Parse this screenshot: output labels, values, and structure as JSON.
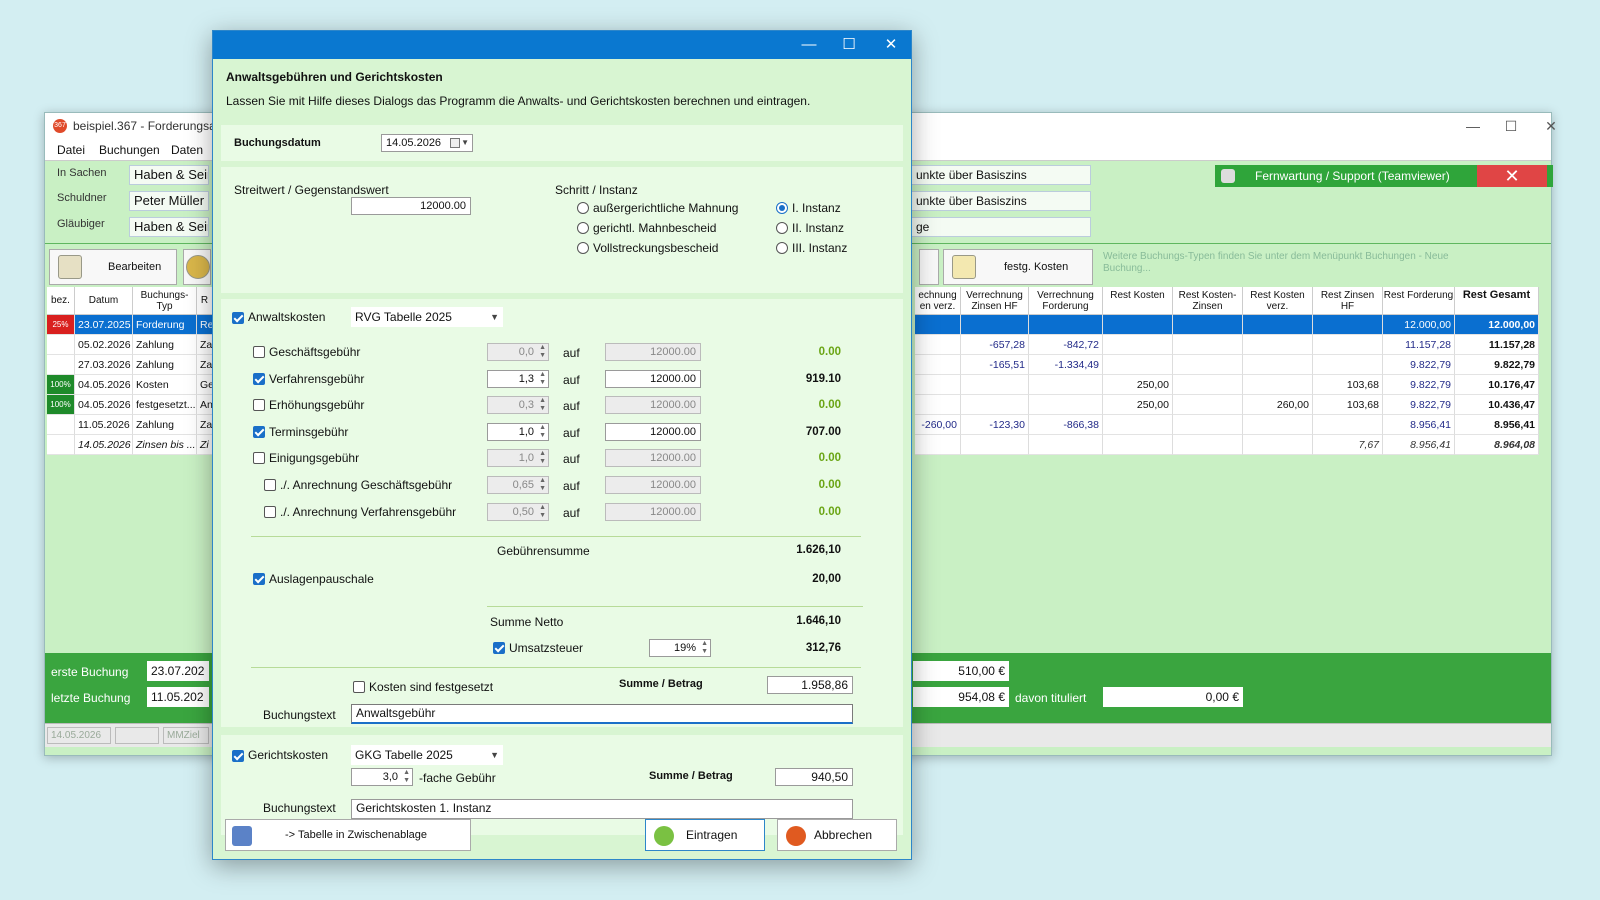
{
  "main_window": {
    "title": "beispiel.367 - Forderungsauf",
    "menu": [
      "Datei",
      "Buchungen",
      "Daten"
    ],
    "teamviewer_label": "Fernwartung / Support (Teamviewer)",
    "fields": [
      {
        "label": "In Sachen",
        "value": "Haben & Sein"
      },
      {
        "label": "Schuldner",
        "value": "Peter Müller"
      },
      {
        "label": "Gläubiger",
        "value": "Haben & Sein"
      }
    ],
    "right_fields": [
      "unkte über Basiszins",
      "unkte über Basiszins",
      "ge"
    ],
    "toolbar": {
      "edit_label": "Bearbeiten",
      "fixed_costs_label": "festg. Kosten"
    },
    "hint_text": "Weitere Buchungs-Typen finden Sie unter dem Menüpunkt Buchungen - Neue Buchung...",
    "left_headers": [
      "bez.",
      "Datum",
      "Buchungs-Typ",
      "R"
    ],
    "right_headers": [
      "echnung en verz.",
      "Verrechnung Zinsen HF",
      "Verrechnung Forderung",
      "Rest Kosten",
      "Rest Kosten-Zinsen",
      "Rest Kosten verz.",
      "Rest Zinsen HF",
      "Rest Forderung",
      "Rest Gesamt"
    ],
    "rows": [
      {
        "badge": "25%",
        "badge_color": "#d9201f",
        "date": "23.07.2025",
        "type": "Forderung",
        "r": "Re",
        "cols": [
          "",
          "",
          "",
          "",
          "",
          "",
          "",
          "12.000,00",
          "12.000,00"
        ],
        "selected": true
      },
      {
        "badge": "",
        "badge_color": "",
        "date": "05.02.2026",
        "type": "Zahlung",
        "r": "Za",
        "cols": [
          "",
          "-657,28",
          "-842,72",
          "",
          "",
          "",
          "",
          "11.157,28",
          "11.157,28"
        ]
      },
      {
        "badge": "",
        "badge_color": "",
        "date": "27.03.2026",
        "type": "Zahlung",
        "r": "Za",
        "cols": [
          "",
          "-165,51",
          "-1.334,49",
          "",
          "",
          "",
          "",
          "9.822,79",
          "9.822,79"
        ]
      },
      {
        "badge": "100%",
        "badge_color": "#1e8a2a",
        "date": "04.05.2026",
        "type": "Kosten",
        "r": "Ge",
        "cols": [
          "",
          "",
          "",
          "250,00",
          "",
          "",
          "103,68",
          "9.822,79",
          "10.176,47"
        ]
      },
      {
        "badge": "100%",
        "badge_color": "#1e8a2a",
        "date": "04.05.2026",
        "type": "festgesetzt...",
        "r": "An",
        "cols": [
          "",
          "",
          "",
          "250,00",
          "",
          "260,00",
          "103,68",
          "9.822,79",
          "10.436,47"
        ]
      },
      {
        "badge": "",
        "badge_color": "",
        "date": "11.05.2026",
        "type": "Zahlung",
        "r": "Za",
        "cols": [
          "-260,00",
          "-123,30",
          "-866,38",
          "",
          "",
          "",
          "",
          "8.956,41",
          "8.956,41"
        ]
      },
      {
        "badge": "",
        "badge_color": "",
        "date": "14.05.2026",
        "type": "Zinsen bis ...",
        "r": "Zi",
        "cols": [
          "",
          "",
          "",
          "",
          "",
          "",
          "7,67",
          "8.956,41",
          "8.964,08"
        ],
        "italic": true
      }
    ],
    "bottom": {
      "first_label": "erste Buchung",
      "first_value": "23.07.202",
      "last_label": "letzte Buchung",
      "last_value": "11.05.202",
      "right_value_1": "510,00 €",
      "right_value_2": "954,08 €",
      "titled_label": "davon tituliert",
      "titled_value": "0,00 €"
    },
    "status": [
      "14.05.2026",
      "",
      "MMZiel"
    ]
  },
  "dialog": {
    "heading": "Anwaltsgebühren und Gerichtskosten",
    "subheading": "Lassen Sie mit Hilfe dieses Dialogs das Programm die Anwalts- und Gerichtskosten berechnen und eintragen.",
    "booking_date_label": "Buchungsdatum",
    "booking_date": "14.05.2026",
    "streitwert_label": "Streitwert / Gegenstandswert",
    "streitwert": "12000.00",
    "schritt_label": "Schritt / Instanz",
    "schritt_options": [
      {
        "label": "außergerichtliche Mahnung",
        "selected": false
      },
      {
        "label": "gerichtl. Mahnbescheid",
        "selected": false
      },
      {
        "label": "Vollstreckungsbescheid",
        "selected": false
      }
    ],
    "instanz_options": [
      {
        "label": "I. Instanz",
        "selected": true
      },
      {
        "label": "II. Instanz",
        "selected": false
      },
      {
        "label": "III. Instanz",
        "selected": false
      }
    ],
    "anwalt_label": "Anwaltskosten",
    "anwalt_checked": true,
    "rvg_table": "RVG Tabelle 2025",
    "auf": "auf",
    "fees": [
      {
        "label": "Geschäftsgebühr",
        "checked": false,
        "factor": "0,0",
        "base": "12000.00",
        "amount": "0.00",
        "indent": false
      },
      {
        "label": "Verfahrensgebühr",
        "checked": true,
        "factor": "1,3",
        "base": "12000.00",
        "amount": "919.10",
        "indent": false
      },
      {
        "label": "Erhöhungsgebühr",
        "checked": false,
        "factor": "0,3",
        "base": "12000.00",
        "amount": "0.00",
        "indent": false
      },
      {
        "label": "Terminsgebühr",
        "checked": true,
        "factor": "1,0",
        "base": "12000.00",
        "amount": "707.00",
        "indent": false
      },
      {
        "label": "Einigungsgebühr",
        "checked": false,
        "factor": "1,0",
        "base": "12000.00",
        "amount": "0.00",
        "indent": false
      },
      {
        "label": "./. Anrechnung Geschäftsgebühr",
        "checked": false,
        "factor": "0,65",
        "base": "12000.00",
        "amount": "0.00",
        "indent": true
      },
      {
        "label": "./. Anrechnung Verfahrensgebühr",
        "checked": false,
        "factor": "0,50",
        "base": "12000.00",
        "amount": "0.00",
        "indent": true
      }
    ],
    "gebuehrensumme_label": "Gebührensumme",
    "gebuehrensumme": "1.626,10",
    "auslagen_label": "Auslagenpauschale",
    "auslagen": "20,00",
    "netto_label": "Summe Netto",
    "netto": "1.646,10",
    "ust_label": "Umsatzsteuer",
    "ust_rate": "19%",
    "ust": "312,76",
    "festgesetzt_label": "Kosten sind festgesetzt",
    "summe_betrag_label": "Summe / Betrag",
    "summe_betrag": "1.958,86",
    "buchungstext_label": "Buchungstext",
    "buchungstext": "Anwaltsgebühr",
    "gericht_label": "Gerichtskosten",
    "gkg_table": "GKG Tabelle 2025",
    "gericht_factor": "3,0",
    "fache_label": "-fache Gebühr",
    "gericht_summe": "940,50",
    "gericht_text": "Gerichtskosten 1. Instanz",
    "clipboard_btn": "-> Tabelle in Zwischenablage",
    "ok_btn": "Eintragen",
    "cancel_btn": "Abbrechen"
  }
}
